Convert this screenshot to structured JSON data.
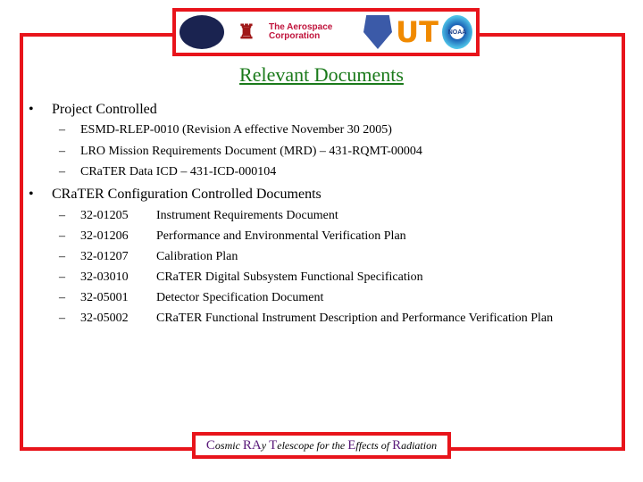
{
  "logos": [
    "seal-logo",
    "academic-logo",
    "The Aerospace Corporation",
    "air-force-shield-logo",
    "UT",
    "NOAA"
  ],
  "title": "Relevant Documents",
  "sections": [
    {
      "bullet": "•",
      "heading": "Project Controlled",
      "items": [
        "ESMD-RLEP-0010 (Revision A effective November 30 2005)",
        "LRO Mission Requirements Document (MRD) – 431-RQMT-00004",
        "CRaTER Data ICD – 431-ICD-000104"
      ]
    },
    {
      "bullet": "•",
      "heading": "CRaTER Configuration Controlled Documents",
      "items": [
        {
          "number": "32-01205",
          "name": "Instrument Requirements Document"
        },
        {
          "number": "32-01206",
          "name": "Performance and Environmental Verification Plan"
        },
        {
          "number": "32-01207",
          "name": "Calibration Plan"
        },
        {
          "number": "32-03010",
          "name": "CRaTER Digital Subsystem Functional Specification"
        },
        {
          "number": "32-05001",
          "name": "Detector Specification Document"
        },
        {
          "number": "32-05002",
          "name": "CRaTER Functional Instrument Description and Performance Verification Plan"
        }
      ]
    }
  ],
  "dash": "–",
  "footer": [
    [
      "C",
      "osmic "
    ],
    [
      "RA",
      "y "
    ],
    [
      "T",
      "elescope for the "
    ],
    [
      "E",
      "ffects of "
    ],
    [
      "R",
      "adiation"
    ]
  ],
  "colors": {
    "frame": "#e8141b",
    "title": "#1a7a1a",
    "footer_caps": "#5a1a7a"
  }
}
